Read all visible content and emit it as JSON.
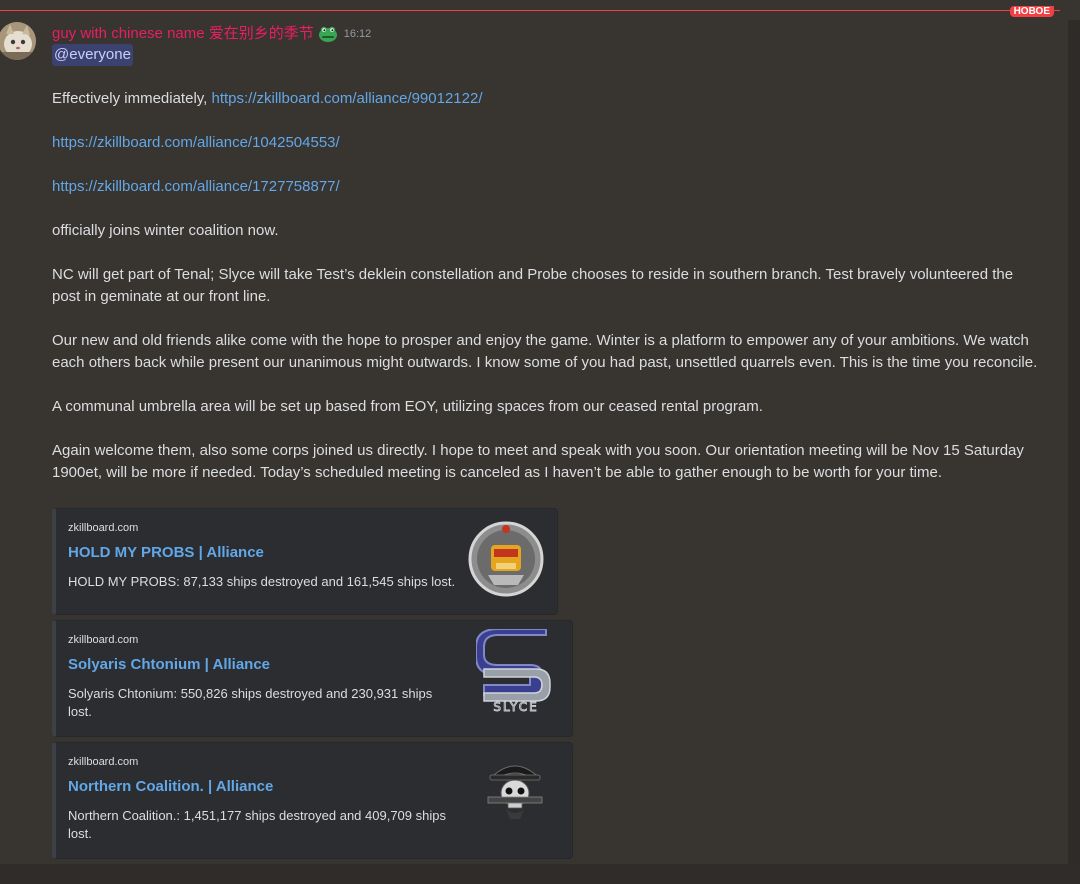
{
  "divider": {
    "badge": "НОВОЕ"
  },
  "message": {
    "author": "guy with chinese name 爱在别乡的季节",
    "author_color": "#e91e63",
    "timestamp": "16:12",
    "mention": "@everyone",
    "lines": {
      "l1_prefix": "Effectively immediately, ",
      "l1_link": "https://zkillboard.com/alliance/99012122/",
      "l2_link": "https://zkillboard.com/alliance/1042504553/",
      "l3_link": "https://zkillboard.com/alliance/1727758877/",
      "l4": "officially joins winter coalition now.",
      "l5": "NC will get part of Tenal; Slyce will take Test’s deklein constellation and Probe chooses to reside in southern branch. Test bravely volunteered the post in geminate at our front line.",
      "l6": "Our new and old friends alike come with the hope to prosper and enjoy the game. Winter is a platform to empower any of your ambitions. We watch each others back while present our unanimous might outwards. I know some of you had past, unsettled quarrels even. This is the time you reconcile.",
      "l7": "A communal umbrella area will be set up based from EOY, utilizing spaces from our ceased rental program.",
      "l8": "Again welcome them, also some corps joined us directly. I hope to meet and speak with you soon. Our orientation meeting will be Nov 15 Saturday 1900et, will be more if needed. Today’s scheduled meeting is canceled as I haven’t be able to gather enough to be worth for your time."
    },
    "link_color": "#62a7e8"
  },
  "embeds": [
    {
      "provider": "zkillboard.com",
      "title": "HOLD MY PROBS | Alliance",
      "description": "HOLD MY PROBS: 87,133 ships destroyed and 161,545 ships lost.",
      "thumb_icon": "hold-my-probs-logo"
    },
    {
      "provider": "zkillboard.com",
      "title": "Solyaris Chtonium | Alliance",
      "description": "Solyaris Chtonium: 550,826 ships destroyed and 230,931 ships lost.",
      "thumb_icon": "slyce-logo",
      "thumb_text": "SLYCE"
    },
    {
      "provider": "zkillboard.com",
      "title": "Northern Coalition. | Alliance",
      "description": "Northern Coalition.: 1,451,177 ships destroyed and 409,709 ships lost.",
      "thumb_icon": "northern-coalition-skull-logo"
    }
  ]
}
